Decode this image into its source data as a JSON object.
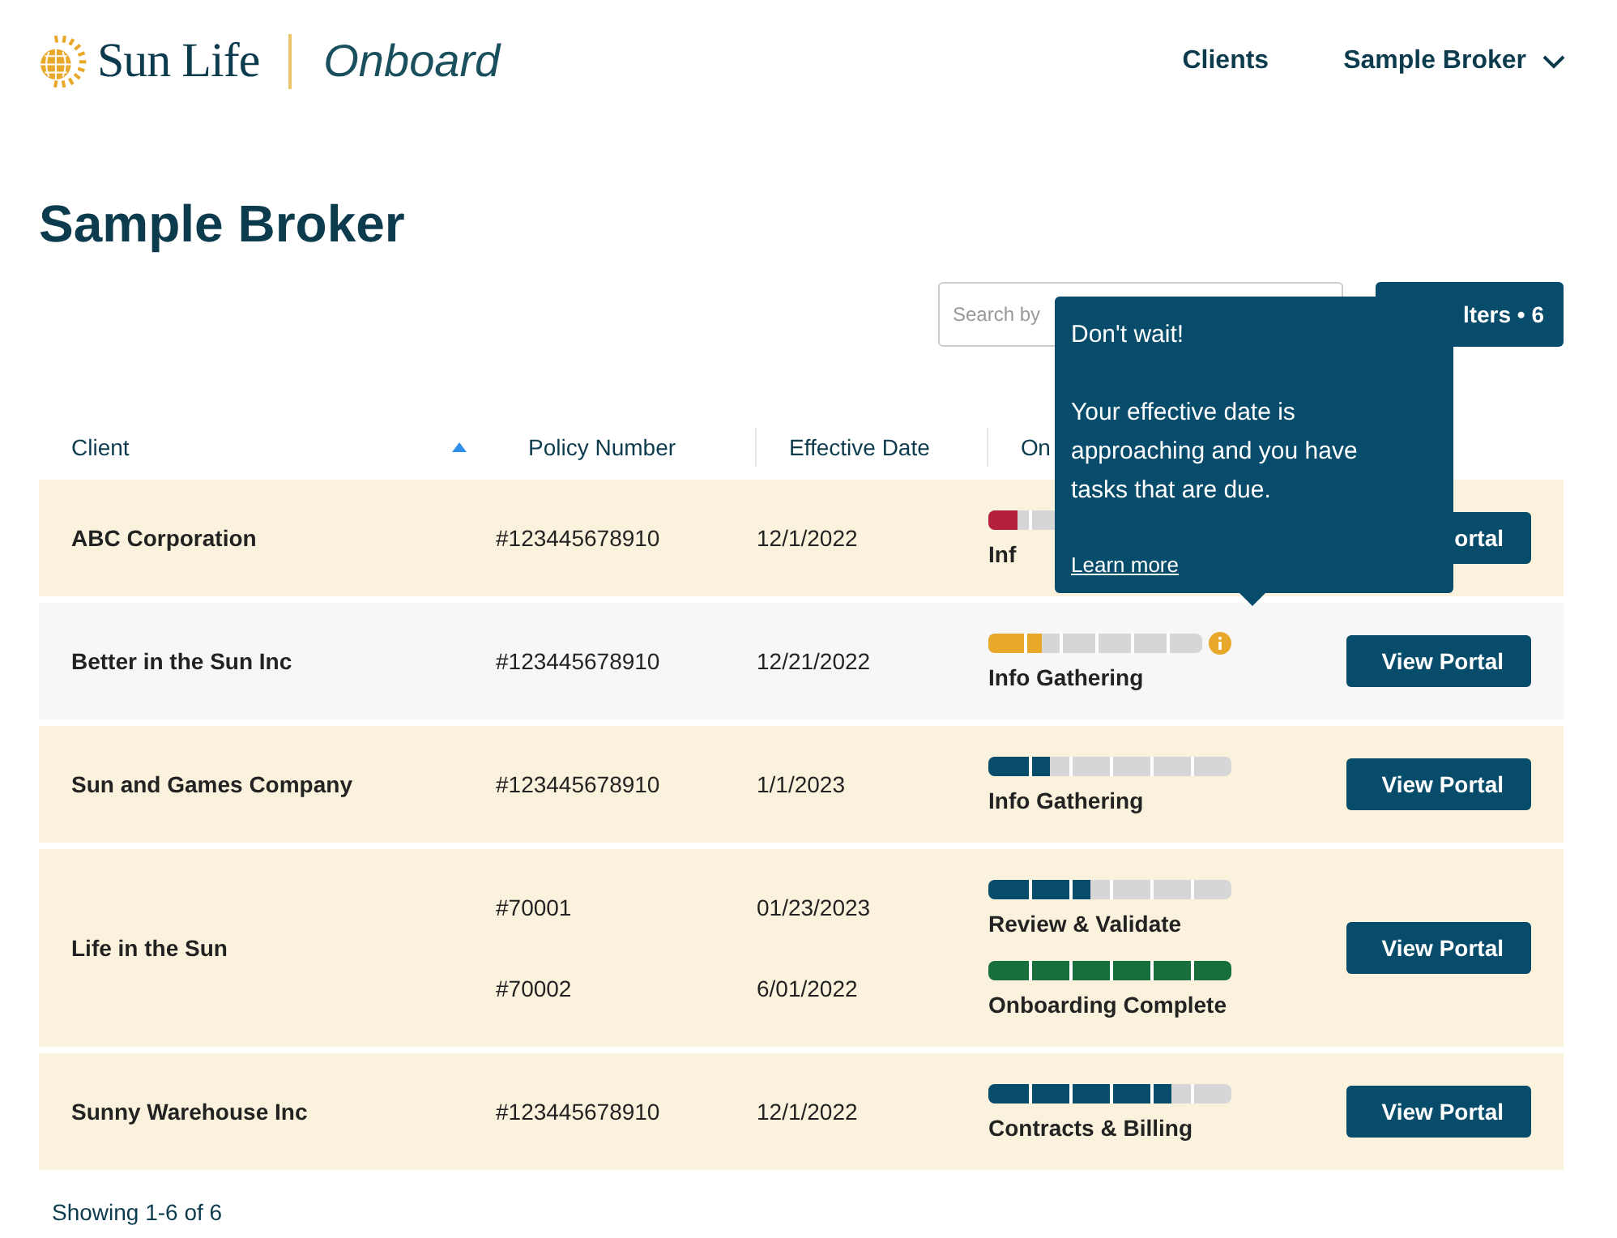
{
  "header": {
    "brand": "Sun Life",
    "product": "Onboard",
    "nav": [
      {
        "label": "Clients",
        "dropdown": false
      },
      {
        "label": "Sample Broker",
        "dropdown": true
      }
    ]
  },
  "page_title": "Sample Broker",
  "toolbar": {
    "search": {
      "placeholder": "Search by"
    },
    "filters_button": "lters • 6"
  },
  "table": {
    "columns": [
      {
        "label": "Client",
        "sorted": true
      },
      {
        "label": "Policy Number",
        "sorted": false
      },
      {
        "label": "Effective Date",
        "sorted": false
      },
      {
        "label": "On",
        "sorted": false
      }
    ],
    "rows": [
      {
        "client": "ABC Corporation",
        "highlighted": false,
        "button": "ortal",
        "policies": [
          {
            "number": "#123445678910",
            "date": "12/1/2022",
            "level": 0.12,
            "color": "#b5203d",
            "stage": "Inf",
            "warning": false
          }
        ]
      },
      {
        "client": "Better in the Sun Inc",
        "highlighted": true,
        "button": "View Portal",
        "policies": [
          {
            "number": "#123445678910",
            "date": "12/21/2022",
            "level": 0.25,
            "color": "#e8a82a",
            "stage": "Info Gathering",
            "warning": true
          }
        ]
      },
      {
        "client": "Sun and Games Company",
        "highlighted": false,
        "button": "View Portal",
        "policies": [
          {
            "number": "#123445678910",
            "date": "1/1/2023",
            "level": 0.25,
            "color": "#084c6b",
            "stage": "Info Gathering",
            "warning": false
          }
        ]
      },
      {
        "client": "Life in the Sun",
        "highlighted": false,
        "button": "View Portal",
        "policies": [
          {
            "number": "#70001",
            "date": "01/23/2023",
            "level": 0.42,
            "color": "#084c6b",
            "stage": "Review & Validate",
            "warning": false
          },
          {
            "number": "#70002",
            "date": "6/01/2022",
            "level": 1,
            "color": "#17703c",
            "stage": "Onboarding Complete",
            "warning": false
          }
        ]
      },
      {
        "client": "Sunny Warehouse Inc",
        "highlighted": false,
        "button": "View Portal",
        "policies": [
          {
            "number": "#123445678910",
            "date": "12/1/2022",
            "level": 0.75,
            "color": "#084c6b",
            "stage": "Contracts & Billing",
            "warning": false
          }
        ]
      }
    ]
  },
  "footer": "Showing 1-6 of 6",
  "tooltip": {
    "title": "Don't wait!",
    "body": "Your effective date is approaching and you have tasks that are due.",
    "link": "Learn more"
  }
}
